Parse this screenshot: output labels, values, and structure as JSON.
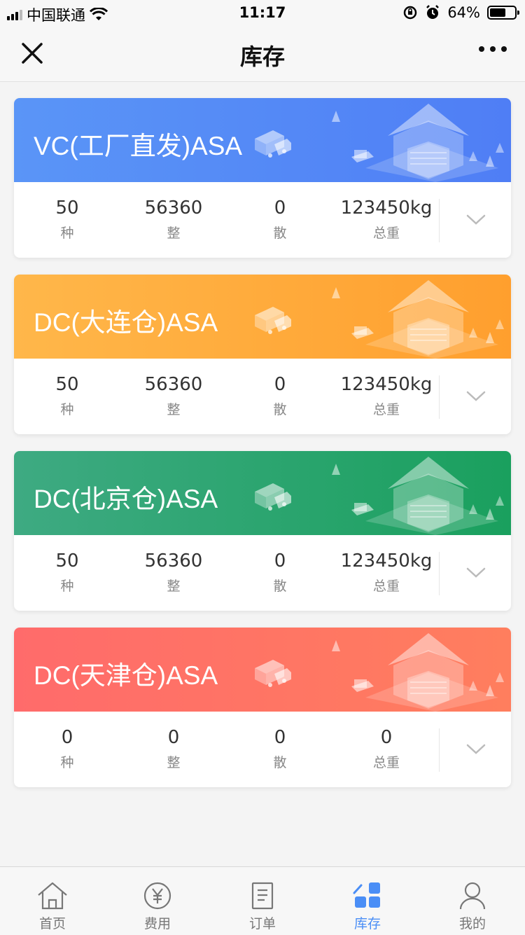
{
  "status_bar": {
    "carrier": "中国联通",
    "time": "11:17",
    "battery_percent": "64%",
    "battery_level": 0.64
  },
  "nav": {
    "title": "库存"
  },
  "cards": [
    {
      "title": "VC(工厂直发)ASA",
      "theme": "blue",
      "colors": {
        "from": "#5a95f7",
        "to": "#4f7ef5"
      },
      "stats": [
        {
          "value": "50",
          "label": "种"
        },
        {
          "value": "56360",
          "label": "整"
        },
        {
          "value": "0",
          "label": "散"
        },
        {
          "value": "123450kg",
          "label": "总重"
        }
      ]
    },
    {
      "title": "DC(大连仓)ASA",
      "theme": "orange",
      "colors": {
        "from": "#ffb74a",
        "to": "#ff9f2e"
      },
      "stats": [
        {
          "value": "50",
          "label": "种"
        },
        {
          "value": "56360",
          "label": "整"
        },
        {
          "value": "0",
          "label": "散"
        },
        {
          "value": "123450kg",
          "label": "总重"
        }
      ]
    },
    {
      "title": "DC(北京仓)ASA",
      "theme": "green",
      "colors": {
        "from": "#3eaa82",
        "to": "#1aa05e"
      },
      "stats": [
        {
          "value": "50",
          "label": "种"
        },
        {
          "value": "56360",
          "label": "整"
        },
        {
          "value": "0",
          "label": "散"
        },
        {
          "value": "123450kg",
          "label": "总重"
        }
      ]
    },
    {
      "title": "DC(天津仓)ASA",
      "theme": "red",
      "colors": {
        "from": "#ff6b6b",
        "to": "#ff7e5e"
      },
      "stats": [
        {
          "value": "0",
          "label": "种"
        },
        {
          "value": "0",
          "label": "整"
        },
        {
          "value": "0",
          "label": "散"
        },
        {
          "value": "0",
          "label": "总重"
        }
      ]
    }
  ],
  "tab_bar": {
    "active_color": "#4a8ef6",
    "tabs": [
      {
        "label": "首页",
        "icon": "home-icon",
        "active": false
      },
      {
        "label": "费用",
        "icon": "yuan-icon",
        "active": false
      },
      {
        "label": "订单",
        "icon": "order-icon",
        "active": false
      },
      {
        "label": "库存",
        "icon": "inventory-icon",
        "active": true
      },
      {
        "label": "我的",
        "icon": "profile-icon",
        "active": false
      }
    ]
  }
}
